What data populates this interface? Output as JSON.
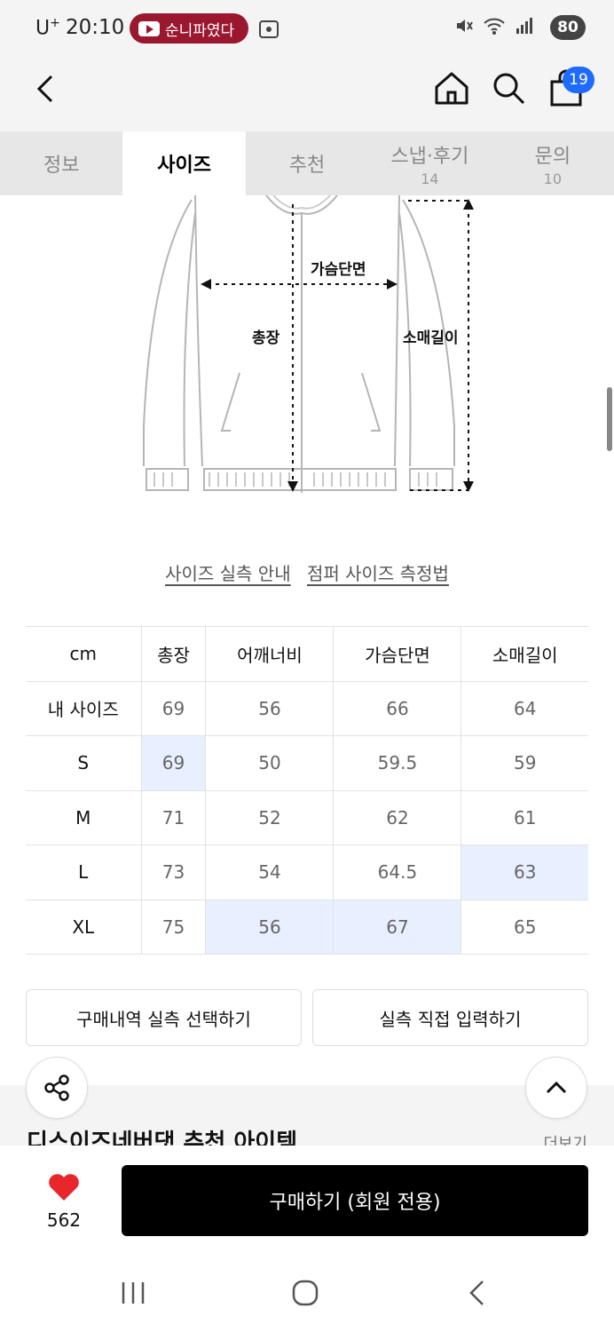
{
  "status": {
    "carrier": "U",
    "carrier_sup": "+",
    "time": "20:10",
    "notification": "순니파였다",
    "battery": "80"
  },
  "header": {
    "cart_count": "19"
  },
  "tabs": [
    {
      "label": "정보",
      "count": ""
    },
    {
      "label": "사이즈",
      "count": ""
    },
    {
      "label": "추천",
      "count": ""
    },
    {
      "label": "스냅·후기",
      "count": "14"
    },
    {
      "label": "문의",
      "count": "10"
    }
  ],
  "diagram": {
    "chest": "가슴단면",
    "length": "총장",
    "sleeve": "소매길이"
  },
  "guide_links": {
    "size_guide": "사이즈 실측 안내",
    "measure_method": "점퍼 사이즈 측정법"
  },
  "size_table": {
    "headers": [
      "cm",
      "총장",
      "어깨너비",
      "가슴단면",
      "소매길이"
    ],
    "rows": [
      {
        "label": "내 사이즈",
        "values": [
          "69",
          "56",
          "66",
          "64"
        ]
      },
      {
        "label": "S",
        "values": [
          "69",
          "50",
          "59.5",
          "59"
        ]
      },
      {
        "label": "M",
        "values": [
          "71",
          "52",
          "62",
          "61"
        ]
      },
      {
        "label": "L",
        "values": [
          "73",
          "54",
          "64.5",
          "63"
        ]
      },
      {
        "label": "XL",
        "values": [
          "75",
          "56",
          "67",
          "65"
        ]
      }
    ]
  },
  "actions": {
    "select_history": "구매내역 실측 선택하기",
    "direct_input": "실측 직접 입력하기"
  },
  "recommend": {
    "title": "디스이즈네버댓 추천 아이템",
    "more": "더보기"
  },
  "bottom": {
    "like_count": "562",
    "buy_label": "구매하기 (회원 전용)"
  },
  "colors": {
    "accent_blue": "#1f6bff",
    "highlight": "#e8effe",
    "heart": "#e8262b",
    "buy_bg": "#000000"
  }
}
